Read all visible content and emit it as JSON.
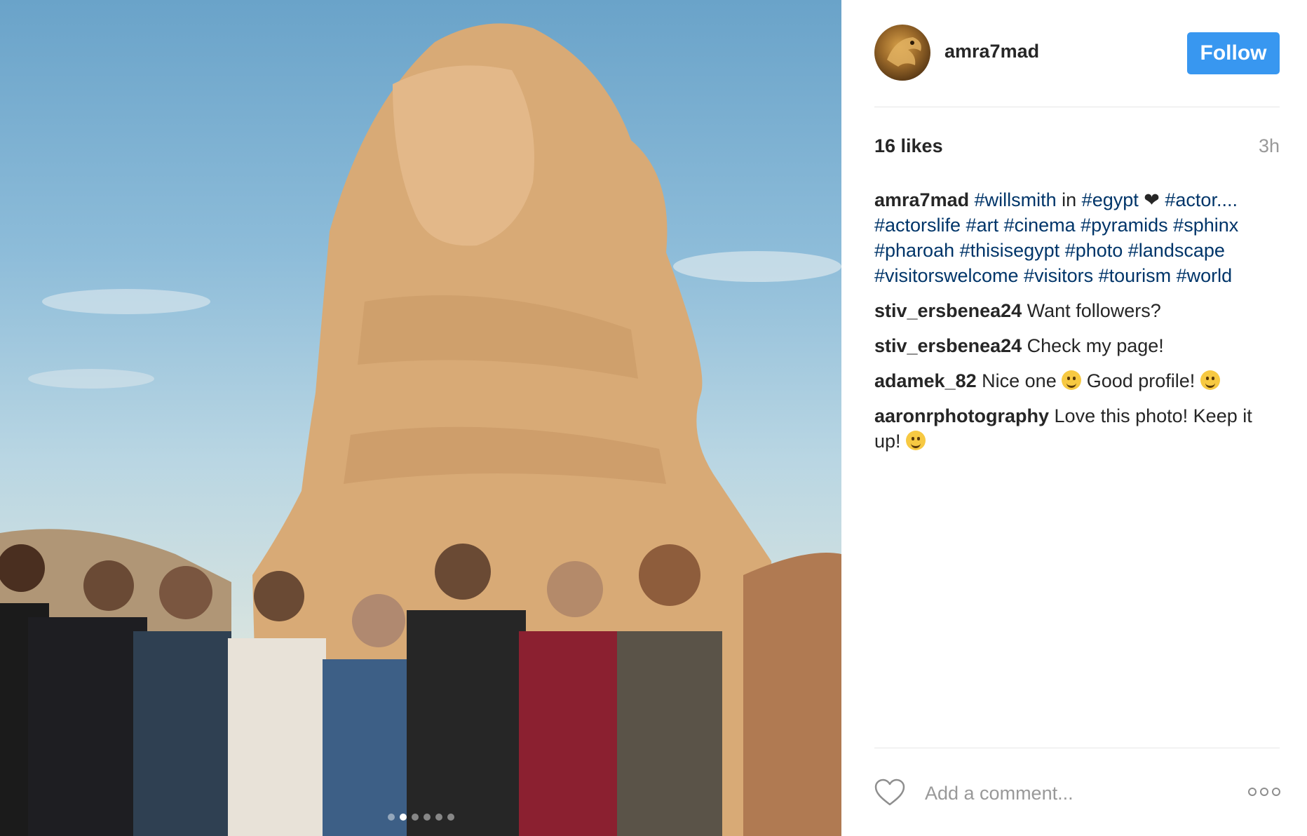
{
  "post": {
    "author": "amra7mad",
    "follow_label": "Follow",
    "likes_label": "16 likes",
    "time_label": "3h",
    "caption": {
      "user": "amra7mad",
      "line1": [
        {
          "t": "#willsmith",
          "tag": true
        },
        {
          "t": " in ",
          "tag": false
        },
        {
          "t": "#egypt",
          "tag": true
        },
        {
          "t": " ❤ ",
          "tag": false
        },
        {
          "t": "#actor....",
          "tag": true
        }
      ],
      "rest": "#actorslife #art #cinema #pyramids #sphinx #pharoah #thisisegypt #photo #landscape #visitorswelcome #visitors #tourism #world"
    },
    "comments": [
      {
        "user": "stiv_ersbenea24",
        "parts": [
          "Want followers?"
        ]
      },
      {
        "user": "stiv_ersbenea24",
        "parts": [
          "Check my page!"
        ]
      },
      {
        "user": "adamek_82",
        "parts": [
          "Nice one ",
          "grin-emoji",
          " Good profile! ",
          "grin-emoji"
        ]
      },
      {
        "user": "aaronrphotography",
        "parts": [
          "Love this photo! Keep it up! ",
          "smile-emoji"
        ]
      }
    ],
    "add_comment_placeholder": "Add a comment...",
    "carousel": {
      "count": 6,
      "active": 1
    }
  },
  "icons": {
    "like": "heart-icon",
    "more": "more-options-icon",
    "avatar": "avatar-image"
  },
  "colors": {
    "follow_button": "#3897f0",
    "hashtag": "#003569",
    "muted": "#999999",
    "text": "#262626"
  }
}
